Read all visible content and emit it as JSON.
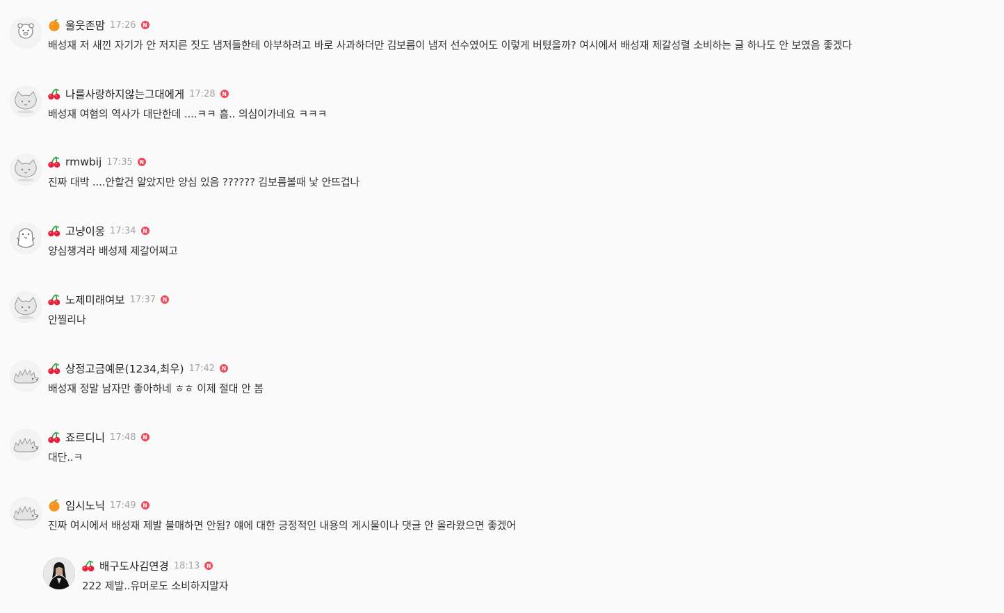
{
  "comments": [
    {
      "level": "orange",
      "avatar": "bear",
      "nickname": "울웃존맘",
      "time": "17:26",
      "badge": "N",
      "text": "배성재 저 새낀 자기가 안 저지른 짓도 냄저들한테 아부하려고 바로 사과하더만 김보름이 냄저 선수였어도 이렇게 버텼을까? 여시에서 배성재 제갈성렬 소비하는 글 하나도 안 보였음 좋겠다"
    },
    {
      "level": "cherry",
      "avatar": "cat",
      "nickname": "나를사랑하지않는그대에게",
      "time": "17:28",
      "badge": "N",
      "text": "배성재 여혐의 역사가 대단한데 ....ㅋㅋ 흠.. 의심이가네요 ㅋㅋㅋ"
    },
    {
      "level": "cherry",
      "avatar": "cat",
      "nickname": "rmwbij",
      "time": "17:35",
      "badge": "N",
      "text": "진짜 대박 ....안할건 알았지만 양심 있음 ?????? 김보름볼때 낯 안뜨겁나"
    },
    {
      "level": "cherry",
      "avatar": "penguin",
      "nickname": "고냥이옹",
      "time": "17:34",
      "badge": "N",
      "text": "양심챙겨라 배성제 제갈어쩌고"
    },
    {
      "level": "cherry",
      "avatar": "cat",
      "nickname": "노제미래여보",
      "time": "17:37",
      "badge": "N",
      "text": "안찔리나"
    },
    {
      "level": "cherry",
      "avatar": "hedgehog",
      "nickname": "상정고금예문(1234,최우)",
      "time": "17:42",
      "badge": "N",
      "text": "배성재 정말 남자만 좋아하네 ㅎㅎ 이제 절대 안 봄"
    },
    {
      "level": "cherry",
      "avatar": "hedgehog",
      "nickname": "죠르디니",
      "time": "17:48",
      "badge": "N",
      "text": "대단..ㅋ"
    },
    {
      "level": "orange",
      "avatar": "hedgehog",
      "nickname": "임시노닉",
      "time": "17:49",
      "badge": "N",
      "text": "진짜 여시에서 배성재 제발 불매하면 안됨? 얘에 대한 긍정적인 내용의 게시물이나 댓글 안 올라왔으면 좋겠어"
    },
    {
      "level": "cherry",
      "avatar": "photo",
      "nickname": "배구도사김연경",
      "time": "18:13",
      "badge": "N",
      "text": "222 제발..유머로도 소비하지말자",
      "reply": true
    }
  ],
  "colors": {
    "new_badge": "#f0495a",
    "time": "#a3a3a3",
    "background": "#fafafa"
  }
}
